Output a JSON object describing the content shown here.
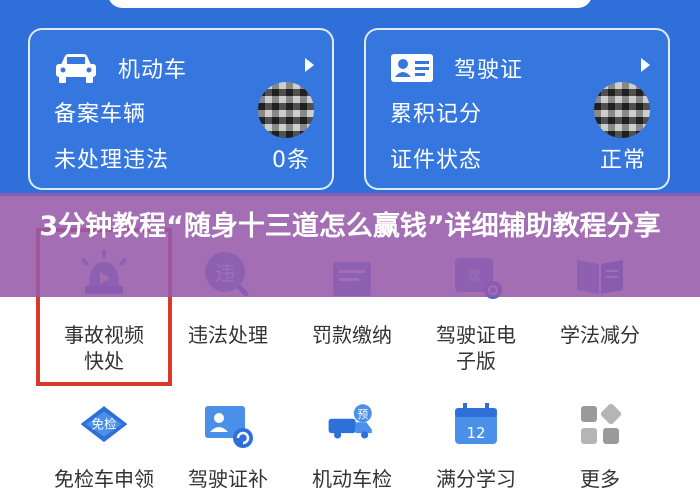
{
  "cards": [
    {
      "title": "机动车",
      "row1": "备案车辆",
      "row2": "未处理违法",
      "value": "0条",
      "icon": "car-icon"
    },
    {
      "title": "驾驶证",
      "row1": "累积记分",
      "row2": "证件状态",
      "value": "正常",
      "icon": "license-card-icon"
    }
  ],
  "services": [
    {
      "label": "事故视频\n快处",
      "icon": "siren-video-icon"
    },
    {
      "label": "违法处理",
      "icon": "violation-icon"
    },
    {
      "label": "罚款缴纳",
      "icon": "fine-icon"
    },
    {
      "label": "驾驶证电\n子版",
      "icon": "electronic-license-icon"
    },
    {
      "label": "学法减分",
      "icon": "book-icon"
    },
    {
      "label": "免检车申领",
      "icon": "inspection-exempt-icon"
    },
    {
      "label": "驾驶证补",
      "icon": "license-reissue-icon"
    },
    {
      "label": "机动车检",
      "icon": "vehicle-inspection-icon"
    },
    {
      "label": "满分学习",
      "icon": "calendar-icon"
    },
    {
      "label": "更多",
      "icon": "more-grid-icon"
    }
  ],
  "banner": {
    "text": "3分钟教程“随身十三道怎么赢钱”详细辅助教程分享"
  },
  "badges": {
    "inspection_exempt": "免检",
    "reserve": "预",
    "calendar_day": "12",
    "license_short": "驾",
    "violation_short": "违"
  },
  "colors": {
    "primary": "#2f6fd9",
    "highlight": "#d9392b",
    "banner": "#965aaa"
  }
}
